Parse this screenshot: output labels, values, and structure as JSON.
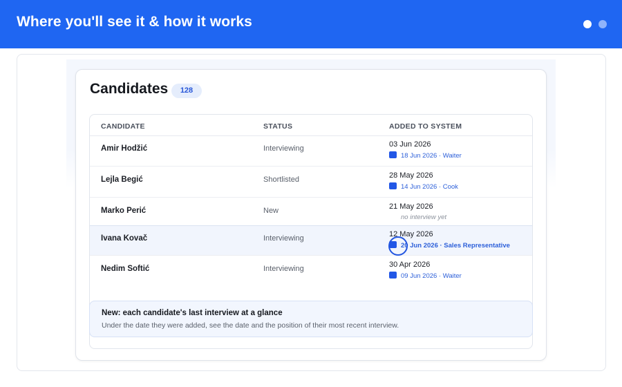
{
  "header": {
    "title": "Where you'll see it & how it works",
    "dots": [
      "pager-dot-active",
      "pager-dot-inactive"
    ]
  },
  "panel": {
    "title": "Candidates",
    "count": "128"
  },
  "table": {
    "columns": [
      "CANDIDATE",
      "STATUS",
      "ADDED TO SYSTEM"
    ],
    "rows": [
      {
        "name": "Amir Hodžić",
        "status": "Interviewing",
        "added": "03 Jun 2026",
        "interview": "18 Jun 2026 · Waiter"
      },
      {
        "name": "Lejla Begić",
        "status": "Shortlisted",
        "added": "28 May 2026",
        "interview": "14 Jun 2026 · Cook"
      },
      {
        "name": "Marko Perić",
        "status": "New",
        "added": "21 May 2026",
        "interview": "no interview yet"
      },
      {
        "name": "Ivana Kovač",
        "status": "Interviewing",
        "added": "12 May 2026",
        "interview": "20 Jun 2026 · Sales Representative"
      },
      {
        "name": "Nedim Softić",
        "status": "Interviewing",
        "added": "30 Apr 2026",
        "interview": "09 Jun 2026 · Waiter"
      }
    ]
  },
  "callout": {
    "title": "New: each candidate's last interview at a glance",
    "text": "Under the date they were added, see the date and the position of their most recent interview."
  },
  "colors": {
    "brand": "#1f66f2",
    "link": "#2c5fd9",
    "highlight_row": "#f1f5fd"
  }
}
